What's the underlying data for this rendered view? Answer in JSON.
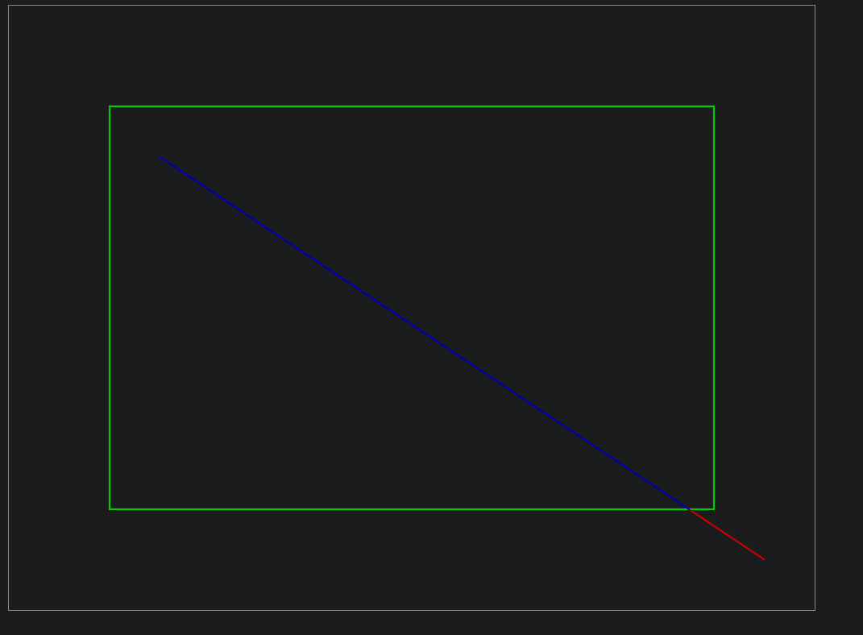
{
  "colors": {
    "background": "#1b1c1e",
    "canvas_border": "#8a8a80",
    "rectangle_stroke": "#00cc00",
    "line_inside": "#0000b0",
    "line_outside": "#cc0000"
  }
}
